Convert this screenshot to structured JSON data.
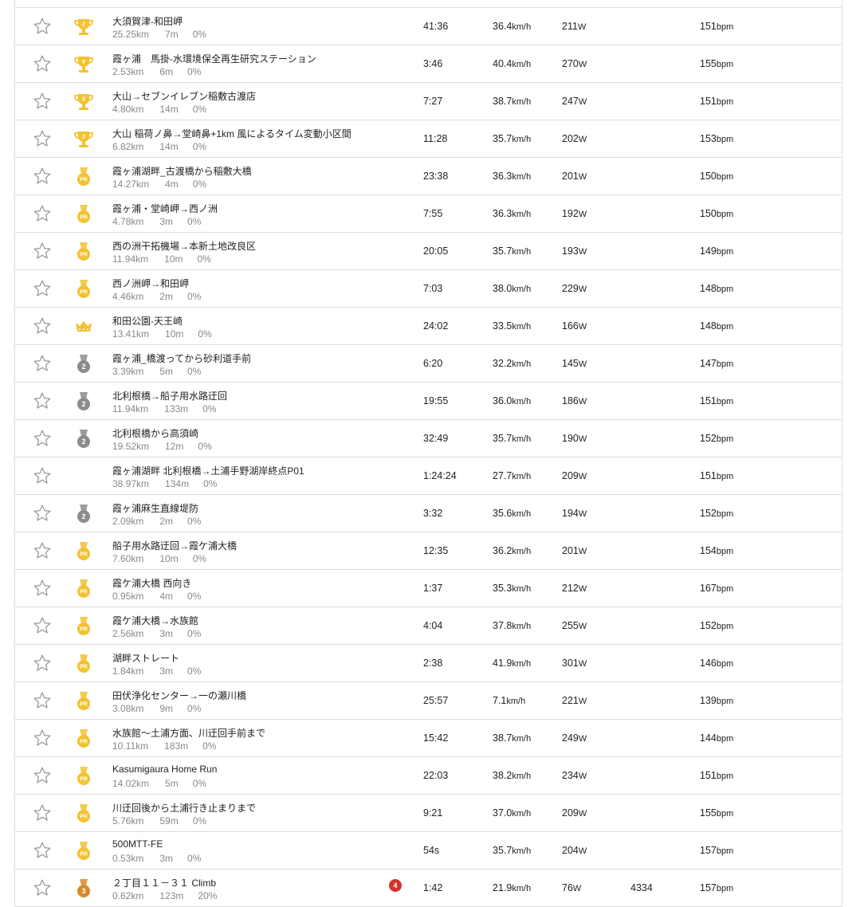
{
  "colors": {
    "gold": "#f2c230",
    "silver": "#8c8c8c",
    "bronze": "#d98a2a",
    "pr": "#f2c230",
    "crown": "#f2c230",
    "star_stroke": "#9a9a9a"
  },
  "segments": [
    {
      "medal": "none",
      "name": "",
      "dist": "",
      "elev": "",
      "grade": "",
      "time": "",
      "speed": "",
      "speed_unit": "",
      "power": "",
      "power_unit": "",
      "hr": "",
      "hr_unit": ""
    },
    {
      "medal": "trophy",
      "medal_text": "2",
      "name": "大須賀津-和田岬",
      "dist": "25.25",
      "dist_unit": "km",
      "elev": "7",
      "elev_unit": "m",
      "grade": "0%",
      "time": "41:36",
      "speed": "36.4",
      "speed_unit": "km/h",
      "power": "211",
      "power_unit": "W",
      "hr": "151",
      "hr_unit": "bpm"
    },
    {
      "medal": "trophy",
      "medal_text": "9",
      "name": "霞ヶ浦　馬掛-水環境保全再生研究ステーション",
      "dist": "2.53",
      "dist_unit": "km",
      "elev": "6",
      "elev_unit": "m",
      "grade": "0%",
      "time": "3:46",
      "speed": "40.4",
      "speed_unit": "km/h",
      "power": "270",
      "power_unit": "W",
      "hr": "155",
      "hr_unit": "bpm"
    },
    {
      "medal": "trophy",
      "medal_text": "5",
      "name": "大山→セブンイレブン稲敷古渡店",
      "dist": "4.80",
      "dist_unit": "km",
      "elev": "14",
      "elev_unit": "m",
      "grade": "0%",
      "time": "7:27",
      "speed": "38.7",
      "speed_unit": "km/h",
      "power": "247",
      "power_unit": "W",
      "hr": "151",
      "hr_unit": "bpm"
    },
    {
      "medal": "trophy",
      "medal_text": "3",
      "name": "大山 稲荷ノ鼻→堂崎鼻+1km 風によるタイム変動小区間",
      "dist": "6.82",
      "dist_unit": "km",
      "elev": "14",
      "elev_unit": "m",
      "grade": "0%",
      "time": "11:28",
      "speed": "35.7",
      "speed_unit": "km/h",
      "power": "202",
      "power_unit": "W",
      "hr": "153",
      "hr_unit": "bpm"
    },
    {
      "medal": "pr",
      "medal_text": "PR",
      "name": "霞ヶ浦湖畔_古渡橋から稲敷大橋",
      "dist": "14.27",
      "dist_unit": "km",
      "elev": "4",
      "elev_unit": "m",
      "grade": "0%",
      "time": "23:38",
      "speed": "36.3",
      "speed_unit": "km/h",
      "power": "201",
      "power_unit": "W",
      "hr": "150",
      "hr_unit": "bpm"
    },
    {
      "medal": "pr",
      "medal_text": "PR",
      "name": "霞ヶ浦・堂崎岬→西ノ洲",
      "dist": "4.78",
      "dist_unit": "km",
      "elev": "3",
      "elev_unit": "m",
      "grade": "0%",
      "time": "7:55",
      "speed": "36.3",
      "speed_unit": "km/h",
      "power": "192",
      "power_unit": "W",
      "hr": "150",
      "hr_unit": "bpm"
    },
    {
      "medal": "pr",
      "medal_text": "PR",
      "name": "西の洲干拓機場→本新土地改良区",
      "dist": "11.94",
      "dist_unit": "km",
      "elev": "10",
      "elev_unit": "m",
      "grade": "0%",
      "time": "20:05",
      "speed": "35.7",
      "speed_unit": "km/h",
      "power": "193",
      "power_unit": "W",
      "hr": "149",
      "hr_unit": "bpm"
    },
    {
      "medal": "pr",
      "medal_text": "PR",
      "name": "西ノ洲岬→和田岬",
      "dist": "4.46",
      "dist_unit": "km",
      "elev": "2",
      "elev_unit": "m",
      "grade": "0%",
      "time": "7:03",
      "speed": "38.0",
      "speed_unit": "km/h",
      "power": "229",
      "power_unit": "W",
      "hr": "148",
      "hr_unit": "bpm"
    },
    {
      "medal": "crown",
      "medal_text": "",
      "name": "和田公園-天王崎",
      "dist": "13.41",
      "dist_unit": "km",
      "elev": "10",
      "elev_unit": "m",
      "grade": "0%",
      "time": "24:02",
      "speed": "33.5",
      "speed_unit": "km/h",
      "power": "166",
      "power_unit": "W",
      "hr": "148",
      "hr_unit": "bpm"
    },
    {
      "medal": "silver",
      "medal_text": "2",
      "name": "霞ヶ浦_橋渡ってから砂利道手前",
      "dist": "3.39",
      "dist_unit": "km",
      "elev": "5",
      "elev_unit": "m",
      "grade": "0%",
      "time": "6:20",
      "speed": "32.2",
      "speed_unit": "km/h",
      "power": "145",
      "power_unit": "W",
      "hr": "147",
      "hr_unit": "bpm"
    },
    {
      "medal": "silver",
      "medal_text": "2",
      "name": "北利根橋→船子用水路迂回",
      "dist": "11.94",
      "dist_unit": "km",
      "elev": "133",
      "elev_unit": "m",
      "grade": "0%",
      "time": "19:55",
      "speed": "36.0",
      "speed_unit": "km/h",
      "power": "186",
      "power_unit": "W",
      "hr": "151",
      "hr_unit": "bpm"
    },
    {
      "medal": "silver",
      "medal_text": "2",
      "name": "北利根橋から高須崎",
      "dist": "19.52",
      "dist_unit": "km",
      "elev": "12",
      "elev_unit": "m",
      "grade": "0%",
      "time": "32:49",
      "speed": "35.7",
      "speed_unit": "km/h",
      "power": "190",
      "power_unit": "W",
      "hr": "152",
      "hr_unit": "bpm"
    },
    {
      "medal": "none",
      "medal_text": "",
      "name": "霞ヶ浦湖畔 北利根橋→土浦手野湖岸終点P01",
      "dist": "38.97",
      "dist_unit": "km",
      "elev": "134",
      "elev_unit": "m",
      "grade": "0%",
      "time": "1:24:24",
      "speed": "27.7",
      "speed_unit": "km/h",
      "power": "209",
      "power_unit": "W",
      "hr": "151",
      "hr_unit": "bpm"
    },
    {
      "medal": "silver",
      "medal_text": "2",
      "name": "霞ヶ浦麻生直線堤防",
      "dist": "2.09",
      "dist_unit": "km",
      "elev": "2",
      "elev_unit": "m",
      "grade": "0%",
      "time": "3:32",
      "speed": "35.6",
      "speed_unit": "km/h",
      "power": "194",
      "power_unit": "W",
      "hr": "152",
      "hr_unit": "bpm"
    },
    {
      "medal": "pr",
      "medal_text": "PR",
      "name": "船子用水路迂回→霞ケ浦大橋",
      "dist": "7.60",
      "dist_unit": "km",
      "elev": "10",
      "elev_unit": "m",
      "grade": "0%",
      "time": "12:35",
      "speed": "36.2",
      "speed_unit": "km/h",
      "power": "201",
      "power_unit": "W",
      "hr": "154",
      "hr_unit": "bpm"
    },
    {
      "medal": "pr",
      "medal_text": "PR",
      "name": "霞ケ浦大橋 西向き",
      "dist": "0.95",
      "dist_unit": "km",
      "elev": "4",
      "elev_unit": "m",
      "grade": "0%",
      "time": "1:37",
      "speed": "35.3",
      "speed_unit": "km/h",
      "power": "212",
      "power_unit": "W",
      "hr": "167",
      "hr_unit": "bpm"
    },
    {
      "medal": "pr",
      "medal_text": "PR",
      "name": "霞ケ浦大橋→水族館",
      "dist": "2.56",
      "dist_unit": "km",
      "elev": "3",
      "elev_unit": "m",
      "grade": "0%",
      "time": "4:04",
      "speed": "37.8",
      "speed_unit": "km/h",
      "power": "255",
      "power_unit": "W",
      "hr": "152",
      "hr_unit": "bpm"
    },
    {
      "medal": "pr",
      "medal_text": "PR",
      "name": "湖畔ストレート",
      "dist": "1.84",
      "dist_unit": "km",
      "elev": "3",
      "elev_unit": "m",
      "grade": "0%",
      "time": "2:38",
      "speed": "41.9",
      "speed_unit": "km/h",
      "power": "301",
      "power_unit": "W",
      "hr": "146",
      "hr_unit": "bpm"
    },
    {
      "medal": "pr",
      "medal_text": "PR",
      "name": "田伏浄化センター→一の瀬川橋",
      "dist": "3.08",
      "dist_unit": "km",
      "elev": "9",
      "elev_unit": "m",
      "grade": "0%",
      "time": "25:57",
      "speed": "7.1",
      "speed_unit": "km/h",
      "power": "221",
      "power_unit": "W",
      "hr": "139",
      "hr_unit": "bpm"
    },
    {
      "medal": "pr",
      "medal_text": "PR",
      "name": "水族館～土浦方面、川迂回手前まで",
      "dist": "10.11",
      "dist_unit": "km",
      "elev": "183",
      "elev_unit": "m",
      "grade": "0%",
      "time": "15:42",
      "speed": "38.7",
      "speed_unit": "km/h",
      "power": "249",
      "power_unit": "W",
      "hr": "144",
      "hr_unit": "bpm"
    },
    {
      "medal": "pr",
      "medal_text": "PR",
      "name": "Kasumigaura Home Run",
      "dist": "14.02",
      "dist_unit": "km",
      "elev": "5",
      "elev_unit": "m",
      "grade": "0%",
      "time": "22:03",
      "speed": "38.2",
      "speed_unit": "km/h",
      "power": "234",
      "power_unit": "W",
      "hr": "151",
      "hr_unit": "bpm"
    },
    {
      "medal": "pr",
      "medal_text": "PR",
      "name": "川迂回後から土浦行き止まりまで",
      "dist": "5.76",
      "dist_unit": "km",
      "elev": "59",
      "elev_unit": "m",
      "grade": "0%",
      "time": "9:21",
      "speed": "37.0",
      "speed_unit": "km/h",
      "power": "209",
      "power_unit": "W",
      "hr": "155",
      "hr_unit": "bpm"
    },
    {
      "medal": "pr",
      "medal_text": "PR",
      "name": "500MTT-FE",
      "dist": "0.53",
      "dist_unit": "km",
      "elev": "3",
      "elev_unit": "m",
      "grade": "0%",
      "time": "54s",
      "speed": "35.7",
      "speed_unit": "km/h",
      "power": "204",
      "power_unit": "W",
      "hr": "157",
      "hr_unit": "bpm"
    },
    {
      "medal": "bronze",
      "medal_text": "3",
      "name": "２丁目１１－３１ Climb",
      "dist": "0.62",
      "dist_unit": "km",
      "elev": "123",
      "elev_unit": "m",
      "grade": "20%",
      "badge": "4",
      "time": "1:42",
      "speed": "21.9",
      "speed_unit": "km/h",
      "power": "76",
      "power_unit": "W",
      "vam": "4334",
      "hr": "157",
      "hr_unit": "bpm"
    }
  ]
}
